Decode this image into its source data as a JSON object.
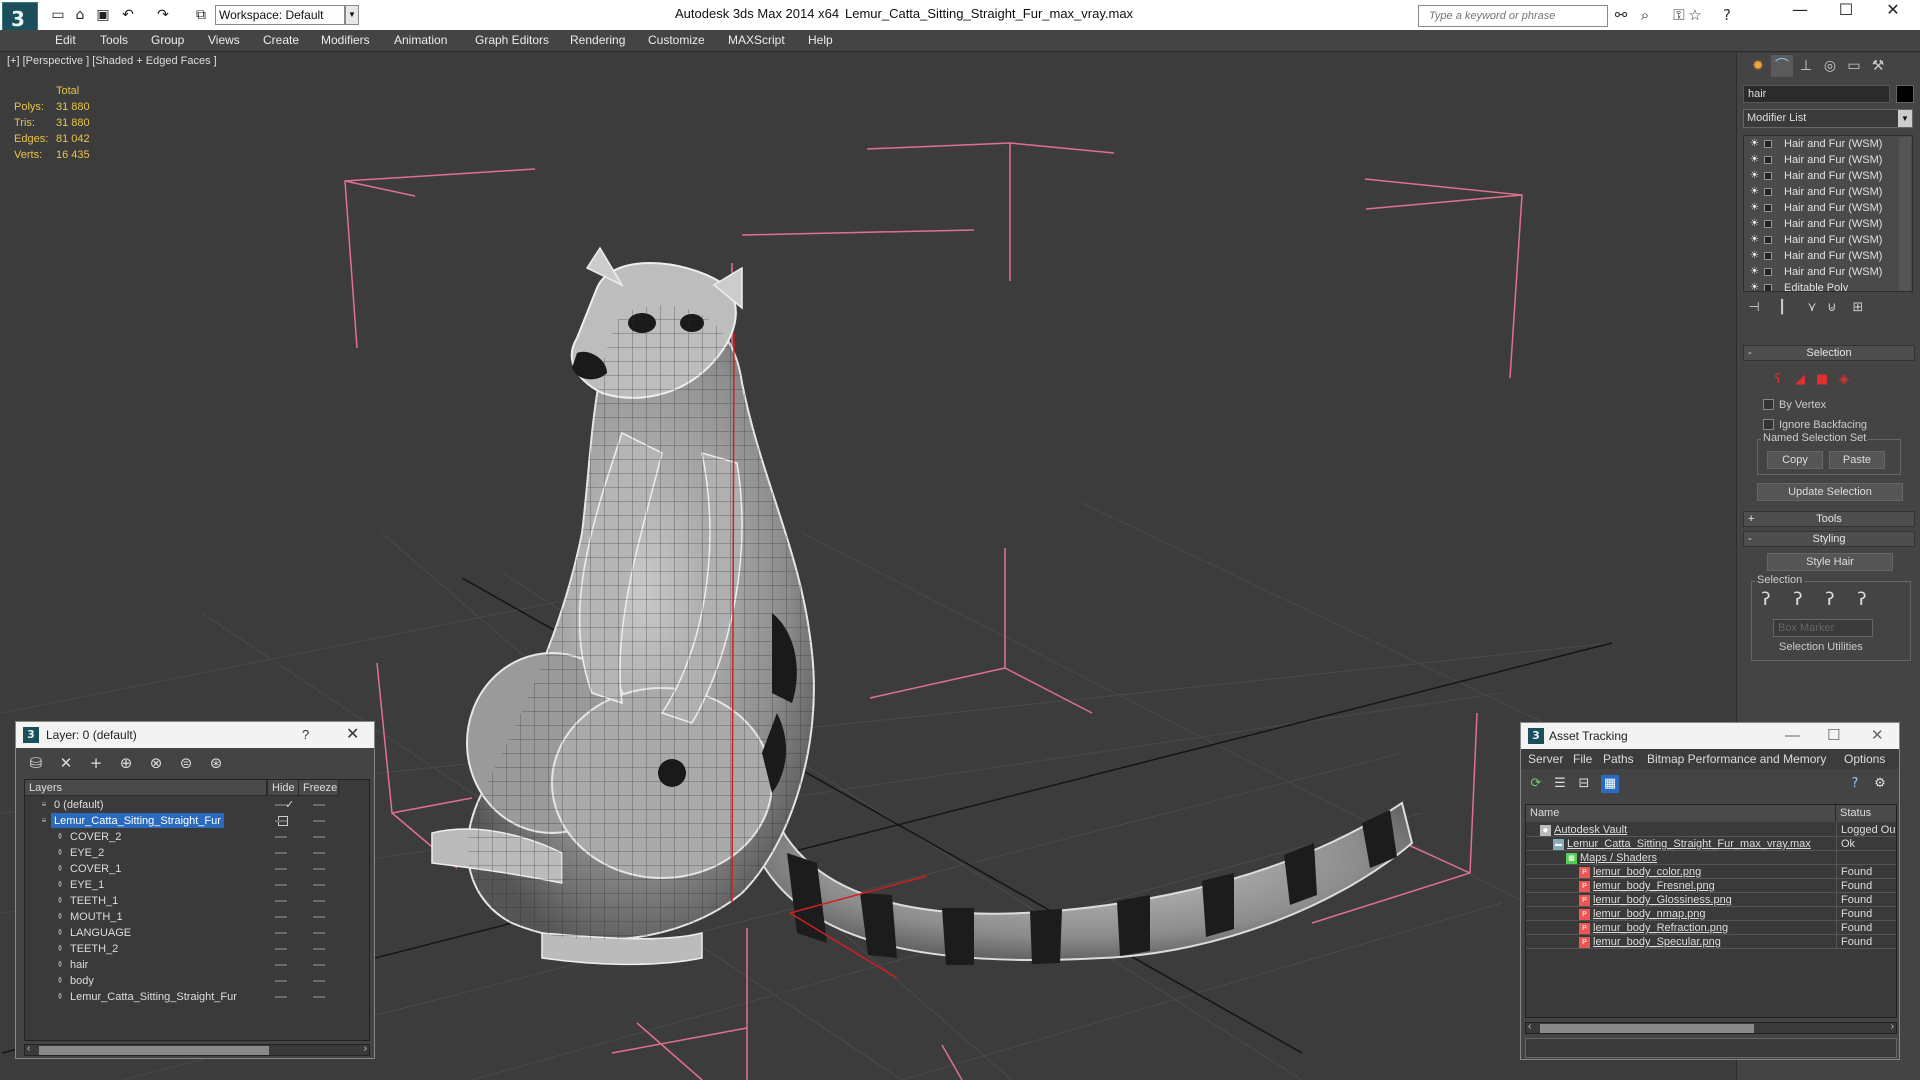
{
  "titlebar": {
    "logo": "3",
    "workspace": "Workspace: Default",
    "app_title": "Autodesk 3ds Max  2014 x64",
    "file_title": "Lemur_Catta_Sitting_Straight_Fur_max_vray.max",
    "search_placeholder": "Type a keyword or phrase",
    "icons": [
      "new-file-icon",
      "open-folder-icon",
      "save-icon",
      "undo-icon",
      "redo-icon",
      "project-folder-icon",
      "binoculars-icon",
      "search-online-icon",
      "key-icon",
      "star-icon",
      "help-icon"
    ],
    "window_buttons": [
      "—",
      "☐",
      "✕"
    ]
  },
  "menubar": [
    "Edit",
    "Tools",
    "Group",
    "Views",
    "Create",
    "Modifiers",
    "Animation",
    "Graph Editors",
    "Rendering",
    "Customize",
    "MAXScript",
    "Help"
  ],
  "viewport": {
    "label": "[+] [Perspective ] [Shaded + Edged Faces ]",
    "stats": {
      "header": "Total",
      "rows": [
        {
          "label": "Polys:",
          "value": "31 880"
        },
        {
          "label": "Tris:",
          "value": "31 880"
        },
        {
          "label": "Edges:",
          "value": "81 042"
        },
        {
          "label": "Verts:",
          "value": "16 435"
        }
      ]
    }
  },
  "command_panel": {
    "object_name": "hair",
    "object_color": "#000000",
    "modifier_list": "Modifier List",
    "stack": [
      "Hair and Fur (WSM)",
      "Hair and Fur (WSM)",
      "Hair and Fur (WSM)",
      "Hair and Fur (WSM)",
      "Hair and Fur (WSM)",
      "Hair and Fur (WSM)",
      "Hair and Fur (WSM)",
      "Hair and Fur (WSM)",
      "Hair and Fur (WSM)",
      "Editable Poly"
    ],
    "selection_rollout": "Selection",
    "by_vertex": "By Vertex",
    "ignore_backfacing": "Ignore Backfacing",
    "named_selection_set": "Named Selection Set",
    "copy": "Copy",
    "paste": "Paste",
    "update_selection": "Update Selection",
    "tools_rollout": "Tools",
    "styling_rollout": "Styling",
    "style_hair": "Style Hair",
    "styling_selection": "Selection",
    "box_marker": "Box Marker",
    "selection_utilities": "Selection Utilities"
  },
  "layer_dialog": {
    "title": "Layer: 0 (default)",
    "help": "?",
    "close": "✕",
    "columns": [
      "Layers",
      "Hide",
      "Freeze"
    ],
    "rows": [
      {
        "name": "0 (default)",
        "level": 0,
        "type": "layer",
        "current": true
      },
      {
        "name": "Lemur_Catta_Sitting_Straight_Fur",
        "level": 0,
        "type": "layer",
        "selected": true
      },
      {
        "name": "COVER_2",
        "level": 1,
        "type": "object"
      },
      {
        "name": "EYE_2",
        "level": 1,
        "type": "object"
      },
      {
        "name": "COVER_1",
        "level": 1,
        "type": "object"
      },
      {
        "name": "EYE_1",
        "level": 1,
        "type": "object"
      },
      {
        "name": "TEETH_1",
        "level": 1,
        "type": "object"
      },
      {
        "name": "MOUTH_1",
        "level": 1,
        "type": "object"
      },
      {
        "name": "LANGUAGE",
        "level": 1,
        "type": "object"
      },
      {
        "name": "TEETH_2",
        "level": 1,
        "type": "object"
      },
      {
        "name": "hair",
        "level": 1,
        "type": "object"
      },
      {
        "name": "body",
        "level": 1,
        "type": "object"
      },
      {
        "name": "Lemur_Catta_Sitting_Straight_Fur",
        "level": 1,
        "type": "object"
      }
    ]
  },
  "asset_dialog": {
    "title": "Asset Tracking",
    "menu": [
      "Server",
      "File",
      "Paths",
      "Bitmap Performance and Memory",
      "Options"
    ],
    "columns": [
      "Name",
      "Status"
    ],
    "rows": [
      {
        "name": "Autodesk Vault",
        "status": "Logged Ou",
        "level": 0,
        "icon": "vault"
      },
      {
        "name": "Lemur_Catta_Sitting_Straight_Fur_max_vray.max",
        "status": "Ok",
        "level": 1,
        "icon": "max"
      },
      {
        "name": "Maps / Shaders",
        "status": "",
        "level": 2,
        "icon": "maps"
      },
      {
        "name": "lemur_body_color.png",
        "status": "Found",
        "level": 3,
        "icon": "png"
      },
      {
        "name": "lemur_body_Fresnel.png",
        "status": "Found",
        "level": 3,
        "icon": "png"
      },
      {
        "name": "lemur_body_Glossiness.png",
        "status": "Found",
        "level": 3,
        "icon": "png"
      },
      {
        "name": "lemur_body_nmap.png",
        "status": "Found",
        "level": 3,
        "icon": "png"
      },
      {
        "name": "lemur_body_Refraction.png",
        "status": "Found",
        "level": 3,
        "icon": "png"
      },
      {
        "name": "lemur_body_Specular.png",
        "status": "Found",
        "level": 3,
        "icon": "png"
      }
    ]
  }
}
